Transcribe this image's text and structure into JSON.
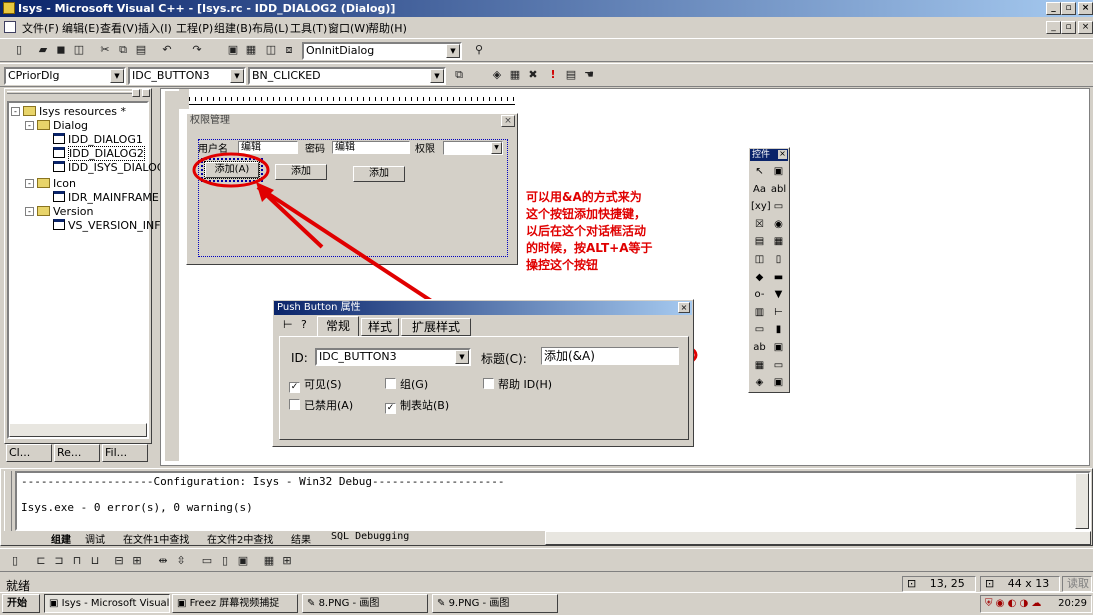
{
  "window": {
    "title": "Isys - Microsoft Visual C++ - [Isys.rc - IDD_DIALOG2 (Dialog)]",
    "btn_min": "_",
    "btn_max": "▫",
    "btn_close": "×",
    "mdi_min": "_",
    "mdi_restore": "▫",
    "mdi_close": "×"
  },
  "menu": [
    "文件(F)",
    "编辑(E)",
    "查看(V)",
    "插入(I)",
    "工程(P)",
    "组建(B)",
    "布局(L)",
    "工具(T)",
    "窗口(W)",
    "帮助(H)"
  ],
  "toolbar": {
    "function_combo": "OnInitDialog",
    "class_combo": "CPriorDlg",
    "id_combo": "IDC_BUTTON3",
    "msg_combo": "BN_CLICKED"
  },
  "tree": {
    "root": "Isys resources *",
    "dialog": "Dialog",
    "d1": "IDD_DIALOG1",
    "d2": "IDD_DIALOG2",
    "d3": "IDD_ISYS_DIALOG",
    "icon": "Icon",
    "i1": "IDR_MAINFRAME",
    "version": "Version",
    "v1": "VS_VERSION_INFO"
  },
  "wtabs": [
    "Cl...",
    "Re...",
    "Fil..."
  ],
  "design_dialog": {
    "title": "权限管理",
    "user_label": "用户名",
    "user_value": "编辑",
    "pwd_label": "密码",
    "pwd_value": "编辑",
    "perm_label": "权限",
    "btn1": "添加(A)",
    "btn2": "添加",
    "btn3": "添加"
  },
  "annotation": [
    "可以用&A的方式来为",
    "这个按钮添加快捷键，",
    "以后在这个对话框活动",
    "的时候，按ALT+A等于",
    "操控这个按钮"
  ],
  "controls_palette": {
    "title": "控件",
    "items": [
      "↖",
      "▣",
      "Aa",
      "abl",
      "[xy]",
      "▭",
      "☒",
      "◉",
      "▤",
      "▦",
      "◫",
      "▯",
      "◆",
      "▬",
      "o-",
      "▼",
      "▥",
      "⊢",
      "▭",
      "▮",
      "ab",
      "▣",
      "▦",
      "▭",
      "◈",
      "▣"
    ]
  },
  "props": {
    "title": "Push Button 属性",
    "pin": "⊢",
    "help": "?",
    "tabs": [
      "常规",
      "样式",
      "扩展样式"
    ],
    "id_label": "ID:",
    "id_value": "IDC_BUTTON3",
    "caption_label": "标题(C):",
    "caption_value": "添加(&A)",
    "visible": "可见(S)",
    "group": "组(G)",
    "helpid": "帮助 ID(H)",
    "disabled": "已禁用(A)",
    "tabstop": "制表站(B)",
    "visible_checked": true,
    "tabstop_checked": true
  },
  "output": {
    "line1": "--------------------Configuration: Isys - Win32 Debug--------------------",
    "line2": "Isys.exe - 0 error(s), 0 warning(s)",
    "tabs": [
      "组建",
      "调试",
      "在文件1中查找",
      "在文件2中查找",
      "结果",
      "SQL Debugging"
    ]
  },
  "status": {
    "text": "就绪",
    "pos": "13, 25",
    "size": "44 x 13",
    "mode": "读取"
  },
  "taskbar": {
    "start": "开始",
    "items": [
      "Isys - Microsoft Visual C...",
      "Freez 屏幕视频捕捉",
      "8.PNG - 画图",
      "9.PNG - 画图"
    ],
    "clock": "20:29"
  },
  "colors": {
    "title_left": "#0a246a",
    "title_right": "#a6caf0",
    "annotation": "#e00000",
    "chrome": "#d4d0c8"
  }
}
